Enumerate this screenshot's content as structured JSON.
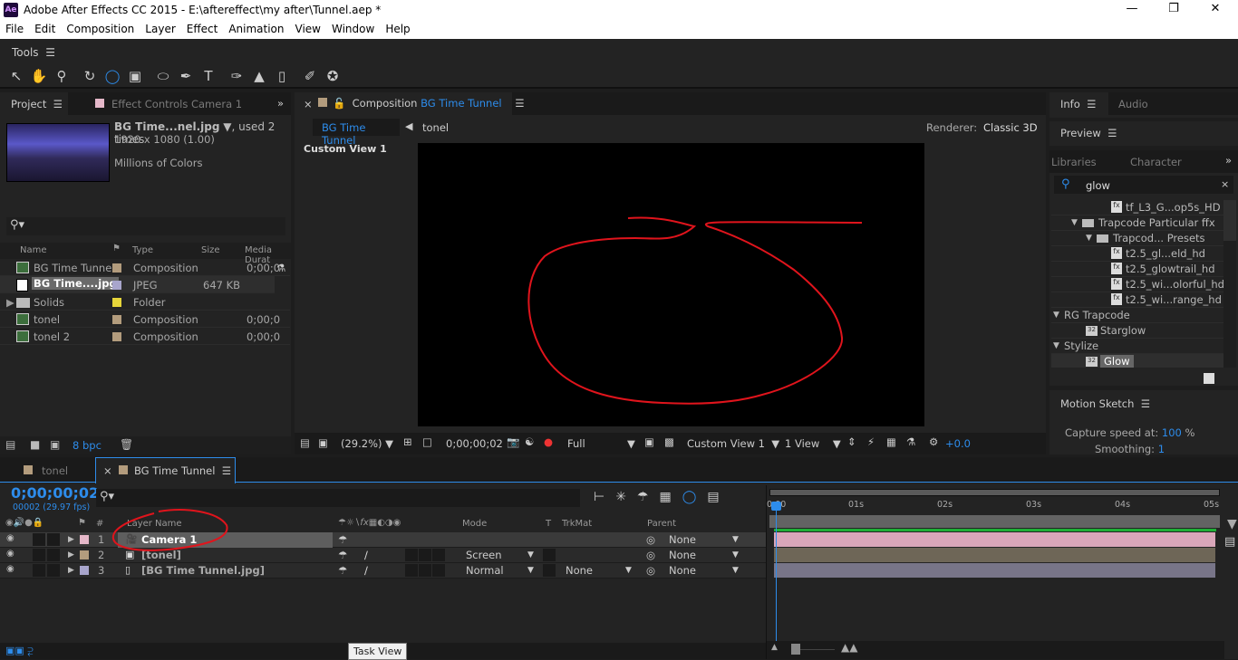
{
  "app": {
    "logo": "Ae",
    "title": "Adobe After Effects CC 2015 - E:\\aftereffect\\my after\\Tunnel.aep *"
  },
  "menu": [
    "File",
    "Edit",
    "Composition",
    "Layer",
    "Effect",
    "Animation",
    "View",
    "Window",
    "Help"
  ],
  "tools": {
    "label": "Tools",
    "icons": [
      "selection-icon",
      "hand-icon",
      "zoom-icon",
      "rotate-icon",
      "camera-orbit-icon",
      "pan-behind-icon",
      "ellipse-icon",
      "pen-icon",
      "type-icon",
      "brush-icon",
      "clone-stamp-icon",
      "eraser-icon",
      "roto-brush-icon",
      "puppet-pin-icon"
    ]
  },
  "project": {
    "tab": "Project",
    "tab2": "Effect Controls",
    "tab2_layer": "Camera 1",
    "preview": {
      "name": "BG Time...nel.jpg",
      "used": ", used 2 times",
      "dims": "1920 x 1080 (1.00)",
      "colors": "Millions of Colors"
    },
    "columns": [
      "Name",
      "Type",
      "Size",
      "Media Durat"
    ],
    "items": [
      {
        "name": "BG Time Tunnel",
        "type": "Composition",
        "size": "",
        "dur": "0;00;0",
        "color": "#b39c7d",
        "icon": "composition-icon"
      },
      {
        "name": "BG Time....jpg",
        "type": "JPEG",
        "size": "647 KB",
        "dur": "",
        "color": "#a8a5cc",
        "icon": "image-file-icon"
      },
      {
        "name": "Solids",
        "type": "Folder",
        "size": "",
        "dur": "",
        "color": "#e6d53a",
        "icon": "folder-icon"
      },
      {
        "name": "tonel",
        "type": "Composition",
        "size": "",
        "dur": "0;00;0",
        "color": "#b39c7d",
        "icon": "composition-icon"
      },
      {
        "name": "tonel 2",
        "type": "Composition",
        "size": "",
        "dur": "0;00;0",
        "color": "#b39c7d",
        "icon": "composition-icon"
      }
    ],
    "bpc": "8 bpc"
  },
  "comp": {
    "tab_label": "Composition",
    "tab_name": "BG Time Tunnel",
    "crumbs": [
      "BG Time Tunnel",
      "tonel"
    ],
    "renderer_label": "Renderer:",
    "renderer": "Classic 3D",
    "view_label": "Custom View 1",
    "footer": {
      "zoom": "(29.2%)",
      "time": "0;00;00;02",
      "resolution": "Full",
      "view": "Custom View 1",
      "layout": "1 View",
      "exposure": "+0.0"
    }
  },
  "right": {
    "info": "Info",
    "audio": "Audio",
    "preview": "Preview",
    "libraries": "Libraries",
    "character": "Character",
    "search": "glow",
    "tree": [
      {
        "label": "tf_L3_G...op5s_HD",
        "level": 3,
        "kind": "preset"
      },
      {
        "label": "Trapcode Particular ffx",
        "level": 1,
        "kind": "folder"
      },
      {
        "label": "Trapcod... Presets",
        "level": 2,
        "kind": "folder"
      },
      {
        "label": "t2.5_gl...eld_hd",
        "level": 3,
        "kind": "preset"
      },
      {
        "label": "t2.5_glowtrail_hd",
        "level": 3,
        "kind": "preset"
      },
      {
        "label": "t2.5_wi...olorful_hd",
        "level": 3,
        "kind": "preset"
      },
      {
        "label": "t2.5_wi...range_hd",
        "level": 3,
        "kind": "preset"
      },
      {
        "label": "RG Trapcode",
        "level": 0,
        "kind": "category"
      },
      {
        "label": "Starglow",
        "level": 2,
        "kind": "effect"
      },
      {
        "label": "Stylize",
        "level": 0,
        "kind": "category"
      },
      {
        "label": "Glow",
        "level": 2,
        "kind": "effect",
        "selected": true
      }
    ],
    "motion_sketch": "Motion Sketch",
    "capture_label": "Capture speed at:",
    "capture_value": "100",
    "capture_unit": "%",
    "smoothing_label": "Smoothing:",
    "smoothing_value": "1"
  },
  "timeline": {
    "tabs": [
      "tonel",
      "BG Time Tunnel"
    ],
    "timecode": "0;00;00;02",
    "frames": "00002 (29.97 fps)",
    "col_layer": "Layer Name",
    "col_num": "#",
    "col_mode": "Mode",
    "col_t": "T",
    "col_trkmat": "TrkMat",
    "col_parent": "Parent",
    "layers": [
      {
        "num": "1",
        "name": "Camera 1",
        "color": "#e5b8c9",
        "mode": "",
        "trkmat": "",
        "parent": "None",
        "icon": "camera-icon"
      },
      {
        "num": "2",
        "name": "[tonel]",
        "color": "#b39c7d",
        "mode": "Screen",
        "trkmat": "",
        "parent": "None",
        "icon": "composition-icon"
      },
      {
        "num": "3",
        "name": "[BG Time Tunnel.jpg]",
        "color": "#a8a5cc",
        "mode": "Normal",
        "trkmat": "None",
        "parent": "None",
        "icon": "image-file-icon"
      }
    ],
    "ruler": [
      "0:00",
      "01s",
      "02s",
      "03s",
      "04s",
      "05s"
    ],
    "bar_colors": [
      "#d9a6b9",
      "#6e6657",
      "#787588"
    ],
    "tooltip": "Task View"
  }
}
